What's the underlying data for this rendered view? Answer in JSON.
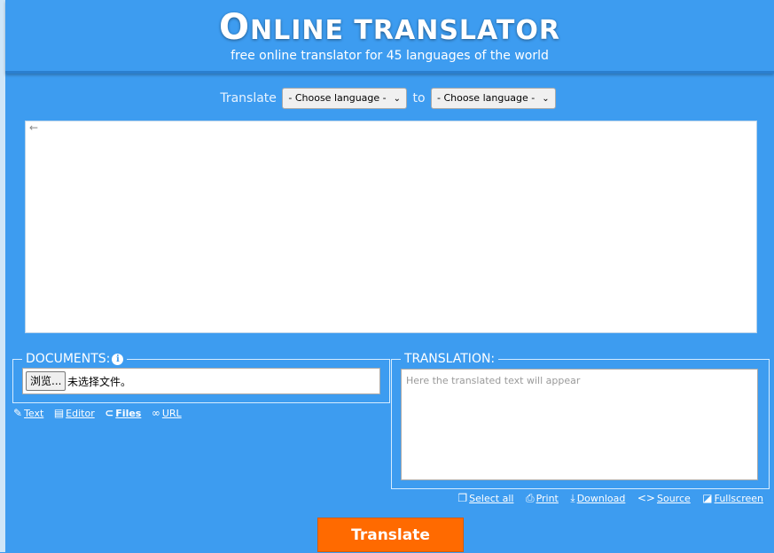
{
  "header": {
    "title_first_letter": "O",
    "title_rest": "NLINE TRANSLATOR",
    "subtitle": "free online translator for 45 languages of the world"
  },
  "language_row": {
    "translate_label": "Translate",
    "source_select_value": "- Choose language -",
    "to_label": "to",
    "target_select_value": "- Choose language -"
  },
  "source_text": {
    "value": "",
    "direction_icon": "←"
  },
  "documents": {
    "legend": "DOCUMENTS:",
    "info_icon": "i",
    "browse_label": "浏览...",
    "file_status": "未选择文件。"
  },
  "input_modes": [
    {
      "label": "Text",
      "icon": "edit-icon",
      "glyph": "✎"
    },
    {
      "label": "Editor",
      "icon": "document-icon",
      "glyph": "▤"
    },
    {
      "label": "Files",
      "icon": "paperclip-icon",
      "glyph": "⊂"
    },
    {
      "label": "URL",
      "icon": "link-icon",
      "glyph": "∞"
    }
  ],
  "translation": {
    "legend": "TRANSLATION:",
    "placeholder": "Here the translated text will appear"
  },
  "tools": [
    {
      "label": "Select all",
      "icon": "copy-icon",
      "glyph": "❐"
    },
    {
      "label": "Print",
      "icon": "print-icon",
      "glyph": "⎙"
    },
    {
      "label": "Download",
      "icon": "download-icon",
      "glyph": "⤓"
    },
    {
      "label": "Source",
      "icon": "code-icon",
      "glyph": "<>"
    },
    {
      "label": "Fullscreen",
      "icon": "fullscreen-icon",
      "glyph": "◪"
    }
  ],
  "translate_button": "Translate",
  "colors": {
    "background": "#3d9cf0",
    "button": "#ff6a00"
  }
}
